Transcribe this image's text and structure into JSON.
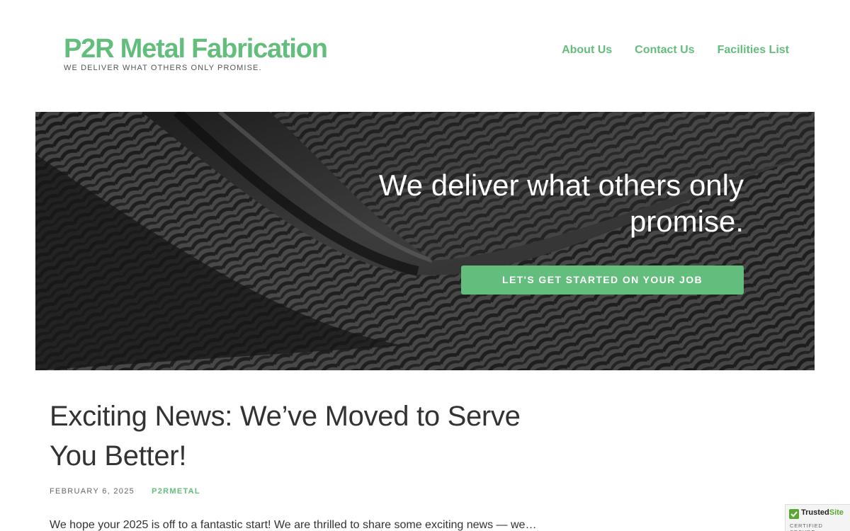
{
  "site": {
    "title": "P2R Metal Fabrication",
    "tagline": "WE DELIVER WHAT OTHERS ONLY PROMISE."
  },
  "nav": {
    "items": [
      {
        "label": "About Us"
      },
      {
        "label": "Contact Us"
      },
      {
        "label": "Facilities List"
      }
    ]
  },
  "hero": {
    "heading": "We deliver what others only promise.",
    "cta_label": "LET'S GET STARTED ON YOUR JOB"
  },
  "post": {
    "title": "Exciting News: We’ve Moved to Serve You Better!",
    "date": "FEBRUARY 6, 2025",
    "author": "P2RMETAL",
    "excerpt": "We hope your 2025 is off to a fantastic start! We are thrilled to share some exciting news — we…"
  },
  "badge": {
    "name_part1": "Trusted",
    "name_part2": "Site",
    "sub": "CERTIFIED SECURE"
  },
  "colors": {
    "accent": "#63bd7c",
    "text": "#333333",
    "hero_bg": "#3a3a3a"
  }
}
